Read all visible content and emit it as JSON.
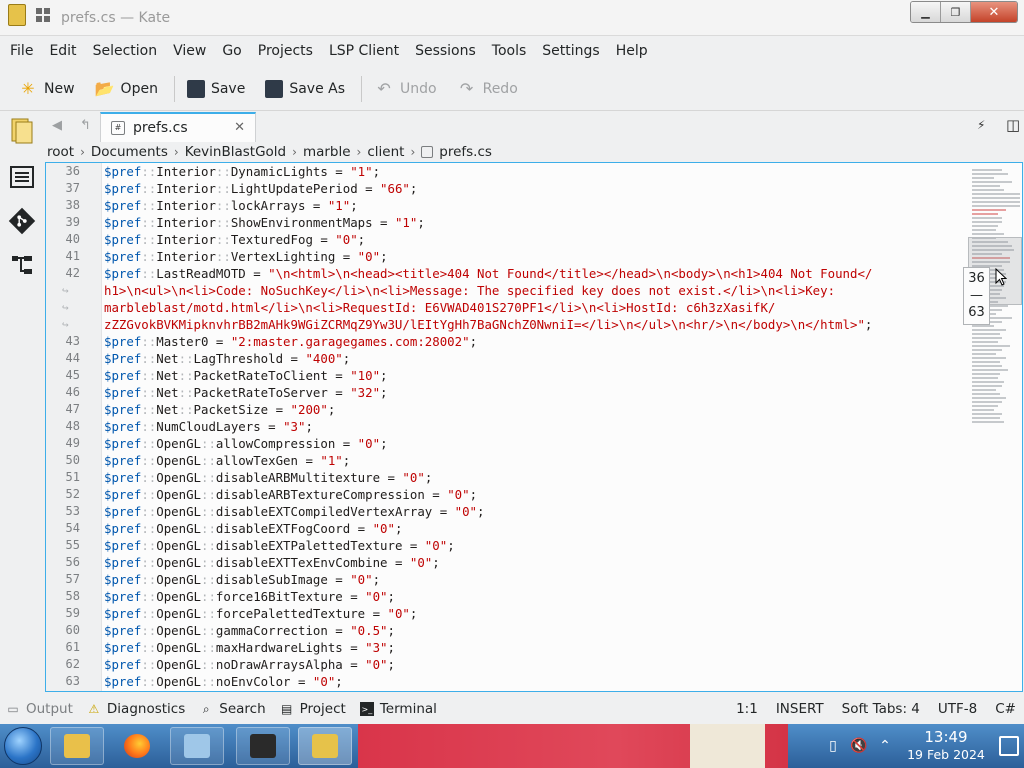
{
  "window": {
    "title": "prefs.cs — Kate",
    "controls": {
      "minimize": "▁",
      "maximize": "❐",
      "close": "✕"
    }
  },
  "menu": [
    "File",
    "Edit",
    "Selection",
    "View",
    "Go",
    "Projects",
    "LSP Client",
    "Sessions",
    "Tools",
    "Settings",
    "Help"
  ],
  "toolbar": {
    "new": "New",
    "open": "Open",
    "save": "Save",
    "save_as": "Save As",
    "undo": "Undo",
    "redo": "Redo"
  },
  "tab": {
    "name": "prefs.cs",
    "close": "✕"
  },
  "breadcrumb": [
    "root",
    "Documents",
    "KevinBlastGold",
    "marble",
    "client",
    "prefs.cs"
  ],
  "editor": {
    "lines": [
      {
        "n": "36",
        "code": "$pref::Interior::DynamicLights = \"1\";"
      },
      {
        "n": "37",
        "code": "$pref::Interior::LightUpdatePeriod = \"66\";"
      },
      {
        "n": "38",
        "code": "$pref::Interior::lockArrays = \"1\";"
      },
      {
        "n": "39",
        "code": "$pref::Interior::ShowEnvironmentMaps = \"1\";"
      },
      {
        "n": "40",
        "code": "$pref::Interior::TexturedFog = \"0\";"
      },
      {
        "n": "41",
        "code": "$pref::Interior::VertexLighting = \"0\";"
      },
      {
        "n": "42",
        "code": "$pref::LastReadMOTD = \"\\n<html>\\n<head><title>404 Not Found</title></head>\\n<body>\\n<h1>404 Not Found</"
      },
      {
        "n": "",
        "code": "h1>\\n<ul>\\n<li>Code: NoSuchKey</li>\\n<li>Message: The specified key does not exist.</li>\\n<li>Key:"
      },
      {
        "n": "",
        "code": "marbleblast/motd.html</li>\\n<li>RequestId: E6VWAD401S270PF1</li>\\n<li>HostId: c6h3zXasifK/"
      },
      {
        "n": "",
        "code": "zZZGvokBVKMipknvhrBB2mAHk9WGiZCRMqZ9Yw3U/lEItYgHh7BaGNchZ0NwniI=</li>\\n</ul>\\n<hr/>\\n</body>\\n</html>\";"
      },
      {
        "n": "43",
        "code": "$pref::Master0 = \"2:master.garagegames.com:28002\";"
      },
      {
        "n": "44",
        "code": "$Pref::Net::LagThreshold = \"400\";"
      },
      {
        "n": "45",
        "code": "$pref::Net::PacketRateToClient = \"10\";"
      },
      {
        "n": "46",
        "code": "$pref::Net::PacketRateToServer = \"32\";"
      },
      {
        "n": "47",
        "code": "$pref::Net::PacketSize = \"200\";"
      },
      {
        "n": "48",
        "code": "$pref::NumCloudLayers = \"3\";"
      },
      {
        "n": "49",
        "code": "$pref::OpenGL::allowCompression = \"0\";"
      },
      {
        "n": "50",
        "code": "$pref::OpenGL::allowTexGen = \"1\";"
      },
      {
        "n": "51",
        "code": "$pref::OpenGL::disableARBMultitexture = \"0\";"
      },
      {
        "n": "52",
        "code": "$pref::OpenGL::disableARBTextureCompression = \"0\";"
      },
      {
        "n": "53",
        "code": "$pref::OpenGL::disableEXTCompiledVertexArray = \"0\";"
      },
      {
        "n": "54",
        "code": "$pref::OpenGL::disableEXTFogCoord = \"0\";"
      },
      {
        "n": "55",
        "code": "$pref::OpenGL::disableEXTPalettedTexture = \"0\";"
      },
      {
        "n": "56",
        "code": "$pref::OpenGL::disableEXTTexEnvCombine = \"0\";"
      },
      {
        "n": "57",
        "code": "$pref::OpenGL::disableSubImage = \"0\";"
      },
      {
        "n": "58",
        "code": "$pref::OpenGL::force16BitTexture = \"0\";"
      },
      {
        "n": "59",
        "code": "$pref::OpenGL::forcePalettedTexture = \"0\";"
      },
      {
        "n": "60",
        "code": "$pref::OpenGL::gammaCorrection = \"0.5\";"
      },
      {
        "n": "61",
        "code": "$pref::OpenGL::maxHardwareLights = \"3\";"
      },
      {
        "n": "62",
        "code": "$pref::OpenGL::noDrawArraysAlpha = \"0\";"
      },
      {
        "n": "63",
        "code": "$pref::OpenGL::noEnvColor = \"0\";"
      }
    ],
    "wrap_marker": "↪",
    "colors": {
      "variable": "#0057ae",
      "operator": "#b3b6b9",
      "string": "#bf0303",
      "focus_border": "#3daee9"
    }
  },
  "scroll_tooltip": {
    "from": "36",
    "sep": "—",
    "to": "63"
  },
  "bottom_panel": {
    "output": "Output",
    "diagnostics": "Diagnostics",
    "search": "Search",
    "project": "Project",
    "terminal": "Terminal"
  },
  "status": {
    "cursor": "1:1",
    "mode": "INSERT",
    "indent": "Soft Tabs: 4",
    "encoding": "UTF-8",
    "language": "C#"
  },
  "taskbar": {
    "time": "13:49",
    "date": "19 Feb 2024"
  }
}
